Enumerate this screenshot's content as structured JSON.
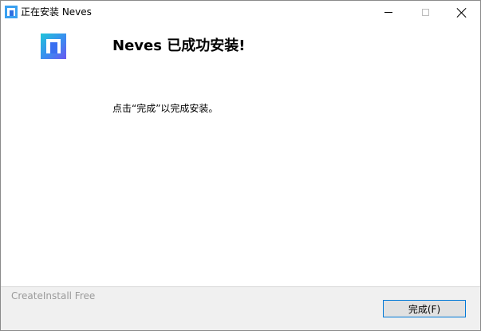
{
  "window": {
    "title": "正在安装 Neves"
  },
  "content": {
    "heading": "Neves 已成功安装!",
    "message": "点击“完成”以完成安装。"
  },
  "footer": {
    "brand_label": "CreateInstall Free",
    "finish_button_label": "完成(F)"
  },
  "colors": {
    "button_border_accent": "#0078d7",
    "footer_background": "#f0f0f0",
    "footer_text": "#9a9a9a"
  },
  "icons": {
    "app": "neves-app-icon",
    "minimize": "minimize-icon",
    "maximize": "maximize-icon",
    "close": "close-icon"
  }
}
